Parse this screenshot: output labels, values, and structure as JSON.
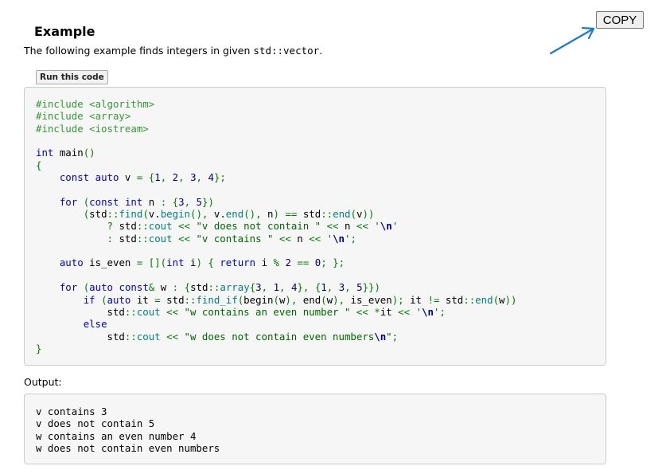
{
  "copy_button": {
    "label": "COPY"
  },
  "example": {
    "heading": "Example",
    "intro_before": "The following example finds integers in given ",
    "intro_code": "std::vector",
    "intro_after": ".",
    "run_button": "Run this code"
  },
  "code_lines": [
    [
      {
        "t": "pre",
        "v": "#include <algorithm>"
      }
    ],
    [
      {
        "t": "pre",
        "v": "#include <array>"
      }
    ],
    [
      {
        "t": "pre",
        "v": "#include <iostream>"
      }
    ],
    [],
    [
      {
        "t": "kw",
        "v": "int"
      },
      {
        "t": "plain",
        "v": " main"
      },
      {
        "t": "br",
        "v": "()"
      }
    ],
    [
      {
        "t": "br",
        "v": "{"
      }
    ],
    [
      {
        "t": "plain",
        "v": "    "
      },
      {
        "t": "kw",
        "v": "const"
      },
      {
        "t": "plain",
        "v": " "
      },
      {
        "t": "kw",
        "v": "auto"
      },
      {
        "t": "plain",
        "v": " v "
      },
      {
        "t": "br",
        "v": "="
      },
      {
        "t": "plain",
        "v": " "
      },
      {
        "t": "br",
        "v": "{"
      },
      {
        "t": "num",
        "v": "1"
      },
      {
        "t": "br",
        "v": ","
      },
      {
        "t": "plain",
        "v": " "
      },
      {
        "t": "num",
        "v": "2"
      },
      {
        "t": "br",
        "v": ","
      },
      {
        "t": "plain",
        "v": " "
      },
      {
        "t": "num",
        "v": "3"
      },
      {
        "t": "br",
        "v": ","
      },
      {
        "t": "plain",
        "v": " "
      },
      {
        "t": "num",
        "v": "4"
      },
      {
        "t": "br",
        "v": "};"
      }
    ],
    [],
    [
      {
        "t": "plain",
        "v": "    "
      },
      {
        "t": "kw",
        "v": "for"
      },
      {
        "t": "plain",
        "v": " "
      },
      {
        "t": "br",
        "v": "("
      },
      {
        "t": "kw",
        "v": "const"
      },
      {
        "t": "plain",
        "v": " "
      },
      {
        "t": "kw",
        "v": "int"
      },
      {
        "t": "plain",
        "v": " n "
      },
      {
        "t": "br",
        "v": ":"
      },
      {
        "t": "plain",
        "v": " "
      },
      {
        "t": "br",
        "v": "{"
      },
      {
        "t": "num",
        "v": "3"
      },
      {
        "t": "br",
        "v": ","
      },
      {
        "t": "plain",
        "v": " "
      },
      {
        "t": "num",
        "v": "5"
      },
      {
        "t": "br",
        "v": "})"
      }
    ],
    [
      {
        "t": "plain",
        "v": "        "
      },
      {
        "t": "br",
        "v": "("
      },
      {
        "t": "plain",
        "v": "std"
      },
      {
        "t": "br",
        "v": "::"
      },
      {
        "t": "ns",
        "v": "find"
      },
      {
        "t": "br",
        "v": "("
      },
      {
        "t": "plain",
        "v": "v."
      },
      {
        "t": "ns",
        "v": "begin"
      },
      {
        "t": "br",
        "v": "(),"
      },
      {
        "t": "plain",
        "v": " v."
      },
      {
        "t": "ns",
        "v": "end"
      },
      {
        "t": "br",
        "v": "(),"
      },
      {
        "t": "plain",
        "v": " n"
      },
      {
        "t": "br",
        "v": ")"
      },
      {
        "t": "plain",
        "v": " "
      },
      {
        "t": "br",
        "v": "=="
      },
      {
        "t": "plain",
        "v": " std"
      },
      {
        "t": "br",
        "v": "::"
      },
      {
        "t": "ns",
        "v": "end"
      },
      {
        "t": "br",
        "v": "("
      },
      {
        "t": "plain",
        "v": "v"
      },
      {
        "t": "br",
        "v": "))"
      }
    ],
    [
      {
        "t": "plain",
        "v": "            "
      },
      {
        "t": "br",
        "v": "?"
      },
      {
        "t": "plain",
        "v": " std"
      },
      {
        "t": "br",
        "v": "::"
      },
      {
        "t": "ns",
        "v": "cout"
      },
      {
        "t": "plain",
        "v": " "
      },
      {
        "t": "br",
        "v": "<<"
      },
      {
        "t": "plain",
        "v": " "
      },
      {
        "t": "str",
        "v": "\"v does not contain \""
      },
      {
        "t": "plain",
        "v": " "
      },
      {
        "t": "br",
        "v": "<<"
      },
      {
        "t": "plain",
        "v": " n "
      },
      {
        "t": "br",
        "v": "<<"
      },
      {
        "t": "plain",
        "v": " "
      },
      {
        "t": "str",
        "v": "'"
      },
      {
        "t": "esc",
        "v": "\\n"
      },
      {
        "t": "str",
        "v": "'"
      }
    ],
    [
      {
        "t": "plain",
        "v": "            "
      },
      {
        "t": "br",
        "v": ":"
      },
      {
        "t": "plain",
        "v": " std"
      },
      {
        "t": "br",
        "v": "::"
      },
      {
        "t": "ns",
        "v": "cout"
      },
      {
        "t": "plain",
        "v": " "
      },
      {
        "t": "br",
        "v": "<<"
      },
      {
        "t": "plain",
        "v": " "
      },
      {
        "t": "str",
        "v": "\"v contains \""
      },
      {
        "t": "plain",
        "v": " "
      },
      {
        "t": "br",
        "v": "<<"
      },
      {
        "t": "plain",
        "v": " n "
      },
      {
        "t": "br",
        "v": "<<"
      },
      {
        "t": "plain",
        "v": " "
      },
      {
        "t": "str",
        "v": "'"
      },
      {
        "t": "esc",
        "v": "\\n"
      },
      {
        "t": "str",
        "v": "'"
      },
      {
        "t": "br",
        "v": ";"
      }
    ],
    [],
    [
      {
        "t": "plain",
        "v": "    "
      },
      {
        "t": "kw",
        "v": "auto"
      },
      {
        "t": "plain",
        "v": " is_even "
      },
      {
        "t": "br",
        "v": "="
      },
      {
        "t": "plain",
        "v": " "
      },
      {
        "t": "br",
        "v": "[]("
      },
      {
        "t": "kw",
        "v": "int"
      },
      {
        "t": "plain",
        "v": " i"
      },
      {
        "t": "br",
        "v": ")"
      },
      {
        "t": "plain",
        "v": " "
      },
      {
        "t": "br",
        "v": "{"
      },
      {
        "t": "plain",
        "v": " "
      },
      {
        "t": "kw",
        "v": "return"
      },
      {
        "t": "plain",
        "v": " i "
      },
      {
        "t": "br",
        "v": "%"
      },
      {
        "t": "plain",
        "v": " "
      },
      {
        "t": "num",
        "v": "2"
      },
      {
        "t": "plain",
        "v": " "
      },
      {
        "t": "br",
        "v": "=="
      },
      {
        "t": "plain",
        "v": " "
      },
      {
        "t": "num",
        "v": "0"
      },
      {
        "t": "br",
        "v": ";"
      },
      {
        "t": "plain",
        "v": " "
      },
      {
        "t": "br",
        "v": "};"
      }
    ],
    [],
    [
      {
        "t": "plain",
        "v": "    "
      },
      {
        "t": "kw",
        "v": "for"
      },
      {
        "t": "plain",
        "v": " "
      },
      {
        "t": "br",
        "v": "("
      },
      {
        "t": "kw",
        "v": "auto"
      },
      {
        "t": "plain",
        "v": " "
      },
      {
        "t": "kw",
        "v": "const"
      },
      {
        "t": "br",
        "v": "&"
      },
      {
        "t": "plain",
        "v": " w "
      },
      {
        "t": "br",
        "v": ":"
      },
      {
        "t": "plain",
        "v": " "
      },
      {
        "t": "br",
        "v": "{"
      },
      {
        "t": "plain",
        "v": "std"
      },
      {
        "t": "br",
        "v": "::"
      },
      {
        "t": "ns",
        "v": "array"
      },
      {
        "t": "br",
        "v": "{"
      },
      {
        "t": "num",
        "v": "3"
      },
      {
        "t": "br",
        "v": ","
      },
      {
        "t": "plain",
        "v": " "
      },
      {
        "t": "num",
        "v": "1"
      },
      {
        "t": "br",
        "v": ","
      },
      {
        "t": "plain",
        "v": " "
      },
      {
        "t": "num",
        "v": "4"
      },
      {
        "t": "br",
        "v": "},"
      },
      {
        "t": "plain",
        "v": " "
      },
      {
        "t": "br",
        "v": "{"
      },
      {
        "t": "num",
        "v": "1"
      },
      {
        "t": "br",
        "v": ","
      },
      {
        "t": "plain",
        "v": " "
      },
      {
        "t": "num",
        "v": "3"
      },
      {
        "t": "br",
        "v": ","
      },
      {
        "t": "plain",
        "v": " "
      },
      {
        "t": "num",
        "v": "5"
      },
      {
        "t": "br",
        "v": "}})"
      }
    ],
    [
      {
        "t": "plain",
        "v": "        "
      },
      {
        "t": "kw",
        "v": "if"
      },
      {
        "t": "plain",
        "v": " "
      },
      {
        "t": "br",
        "v": "("
      },
      {
        "t": "kw",
        "v": "auto"
      },
      {
        "t": "plain",
        "v": " it "
      },
      {
        "t": "br",
        "v": "="
      },
      {
        "t": "plain",
        "v": " std"
      },
      {
        "t": "br",
        "v": "::"
      },
      {
        "t": "ns",
        "v": "find_if"
      },
      {
        "t": "br",
        "v": "("
      },
      {
        "t": "plain",
        "v": "begin"
      },
      {
        "t": "br",
        "v": "("
      },
      {
        "t": "plain",
        "v": "w"
      },
      {
        "t": "br",
        "v": "),"
      },
      {
        "t": "plain",
        "v": " end"
      },
      {
        "t": "br",
        "v": "("
      },
      {
        "t": "plain",
        "v": "w"
      },
      {
        "t": "br",
        "v": "),"
      },
      {
        "t": "plain",
        "v": " is_even"
      },
      {
        "t": "br",
        "v": ");"
      },
      {
        "t": "plain",
        "v": " it "
      },
      {
        "t": "br",
        "v": "!="
      },
      {
        "t": "plain",
        "v": " std"
      },
      {
        "t": "br",
        "v": "::"
      },
      {
        "t": "ns",
        "v": "end"
      },
      {
        "t": "br",
        "v": "("
      },
      {
        "t": "plain",
        "v": "w"
      },
      {
        "t": "br",
        "v": "))"
      }
    ],
    [
      {
        "t": "plain",
        "v": "            std"
      },
      {
        "t": "br",
        "v": "::"
      },
      {
        "t": "ns",
        "v": "cout"
      },
      {
        "t": "plain",
        "v": " "
      },
      {
        "t": "br",
        "v": "<<"
      },
      {
        "t": "plain",
        "v": " "
      },
      {
        "t": "str",
        "v": "\"w contains an even number \""
      },
      {
        "t": "plain",
        "v": " "
      },
      {
        "t": "br",
        "v": "<<"
      },
      {
        "t": "plain",
        "v": " "
      },
      {
        "t": "br",
        "v": "*"
      },
      {
        "t": "plain",
        "v": "it "
      },
      {
        "t": "br",
        "v": "<<"
      },
      {
        "t": "plain",
        "v": " "
      },
      {
        "t": "str",
        "v": "'"
      },
      {
        "t": "esc",
        "v": "\\n"
      },
      {
        "t": "str",
        "v": "'"
      },
      {
        "t": "br",
        "v": ";"
      }
    ],
    [
      {
        "t": "plain",
        "v": "        "
      },
      {
        "t": "kw",
        "v": "else"
      }
    ],
    [
      {
        "t": "plain",
        "v": "            std"
      },
      {
        "t": "br",
        "v": "::"
      },
      {
        "t": "ns",
        "v": "cout"
      },
      {
        "t": "plain",
        "v": " "
      },
      {
        "t": "br",
        "v": "<<"
      },
      {
        "t": "plain",
        "v": " "
      },
      {
        "t": "str",
        "v": "\"w does not contain even numbers"
      },
      {
        "t": "esc",
        "v": "\\n"
      },
      {
        "t": "str",
        "v": "\""
      },
      {
        "t": "br",
        "v": ";"
      }
    ],
    [
      {
        "t": "br",
        "v": "}"
      }
    ]
  ],
  "output": {
    "label": "Output:",
    "lines": [
      "v contains 3",
      "v does not contain 5",
      "w contains an even number 4",
      "w does not contain even numbers"
    ]
  },
  "colors": {
    "preprocessor": "#339933",
    "keyword": "#0000dd",
    "bracket": "#008000",
    "number": "#000080",
    "string": "#006600",
    "escape": "#000099",
    "namespace_member": "#008080",
    "arrow": "#1a7ad0"
  },
  "icons": {
    "arrow": "arrow-pointing-to-copy-icon"
  }
}
